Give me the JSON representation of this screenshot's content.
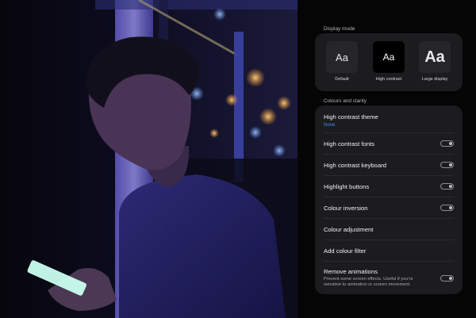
{
  "display_mode": {
    "section_title": "Display mode",
    "options": [
      {
        "preview": "Aa",
        "label": "Default"
      },
      {
        "preview": "Aa",
        "label": "High contrast"
      },
      {
        "preview": "Aa",
        "label": "Large display"
      }
    ]
  },
  "colours_clarity": {
    "section_title": "Colours and clarity",
    "items": [
      {
        "title": "High contrast theme",
        "value": "None"
      },
      {
        "title": "High contrast fonts",
        "toggle": false
      },
      {
        "title": "High contrast keyboard",
        "toggle": false
      },
      {
        "title": "Highlight buttons",
        "toggle": false
      },
      {
        "title": "Colour inversion",
        "toggle": false
      },
      {
        "title": "Colour adjustment"
      },
      {
        "title": "Add colour filter"
      },
      {
        "title": "Remove animations",
        "description": "Prevent some screen effects. Useful if you're sensitive to animation or screen movement.",
        "toggle": false
      }
    ]
  },
  "colors": {
    "accent_blue": "#3f8ef0",
    "card": "#1c1c1f",
    "background": "#050506"
  }
}
